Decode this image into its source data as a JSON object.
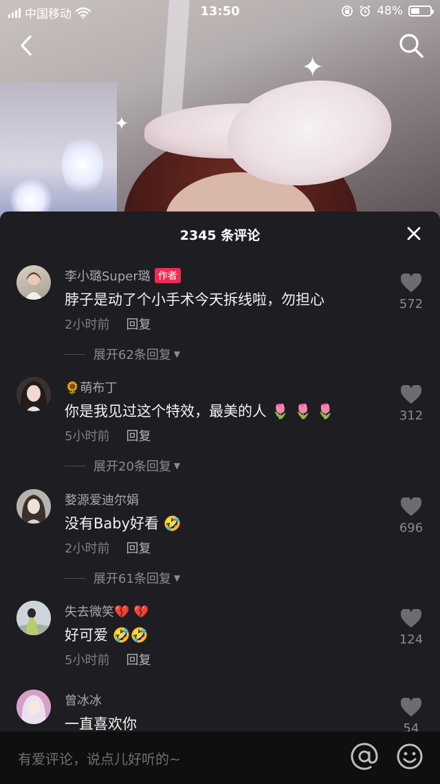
{
  "status_bar": {
    "carrier": "中国移动",
    "time": "13:50",
    "battery_percent": "48%",
    "battery_level": 0.48
  },
  "header": {
    "back_icon": "chevron-left-icon",
    "search_icon": "search-icon"
  },
  "comments_sheet": {
    "title": "2345 条评论",
    "close_icon": "close-icon",
    "comments": [
      {
        "username": "李小璐Super璐",
        "badge": "作者",
        "text": "脖子是动了个小手术今天拆线啦，勿担心",
        "time": "2小时前",
        "reply_label": "回复",
        "expand_label": "展开62条回复",
        "likes": "572",
        "avatar_color": "#b9b1a2"
      },
      {
        "username": "🌻萌布丁",
        "text": "你是我见过这个特效，最美的人 🌷 🌷 🌷",
        "time": "5小时前",
        "reply_label": "回复",
        "expand_label": "展开20条回复",
        "likes": "312",
        "avatar_color": "#4a3f3c"
      },
      {
        "username": "婺源爱迪尔娟",
        "text": "没有Baby好看 🤣",
        "time": "2小时前",
        "reply_label": "回复",
        "expand_label": "展开61条回复",
        "likes": "696",
        "avatar_color": "#8c8a88"
      },
      {
        "username": "失去微笑💔 💔",
        "text": "好可爱 🤣🤣",
        "time": "5小时前",
        "reply_label": "回复",
        "likes": "124",
        "avatar_color": "#6f8a64"
      },
      {
        "username": "曾冰冰",
        "text": "一直喜欢你",
        "likes": "54",
        "avatar_color": "#c58fb7"
      }
    ]
  },
  "input_bar": {
    "placeholder": "有爱评论，说点儿好听的~",
    "at_icon": "at-icon",
    "emoji_icon": "emoji-icon"
  }
}
